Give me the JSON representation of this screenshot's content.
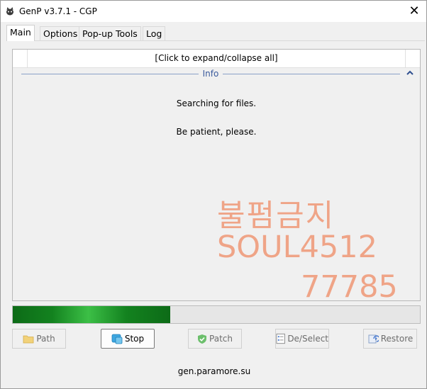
{
  "window": {
    "title": "GenP v3.7.1 - CGP",
    "close_glyph": "✕"
  },
  "tabs": [
    {
      "label": "Main",
      "active": true
    },
    {
      "label": "Options",
      "active": false
    },
    {
      "label": "Pop-up Tools",
      "active": false
    },
    {
      "label": "Log",
      "active": false
    }
  ],
  "panel": {
    "expand_label": "[Click to expand/collapse all]",
    "group_title": "Info",
    "messages": [
      "Searching for files.",
      "Be patient, please."
    ]
  },
  "progress": {
    "value": 0.386,
    "color": "#13821f"
  },
  "buttons": {
    "path": "Path",
    "stop": "Stop",
    "patch": "Patch",
    "deselect": "De/Select",
    "restore": "Restore"
  },
  "footer": {
    "link": "gen.paramore.su"
  },
  "watermark": {
    "line1": "불펌금지",
    "line2": "SOUL4512",
    "line3": "77785",
    "color": "#ef9c7c"
  },
  "icons": {
    "app": "cat-app-icon",
    "path": "folder-icon",
    "stop": "stop-icon",
    "patch": "shield-check-icon",
    "deselect": "checklist-icon",
    "restore": "restore-icon",
    "collapse": "chevron-up-icon"
  }
}
